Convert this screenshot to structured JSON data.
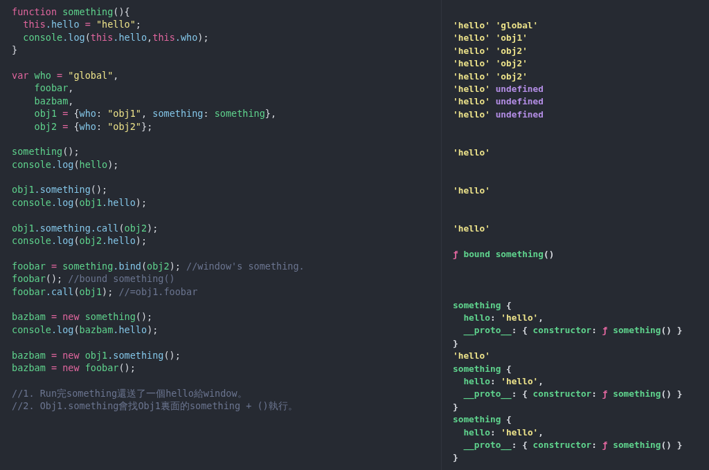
{
  "editor": {
    "lines": [
      {
        "kind": "code",
        "tokens": [
          {
            "kind": "keyword",
            "text": "function"
          },
          {
            "kind": "function",
            "text": " something"
          },
          {
            "kind": "punct",
            "text": "(){"
          }
        ]
      },
      {
        "kind": "code",
        "tokens": [
          {
            "kind": "keyword",
            "text": "  this"
          },
          {
            "kind": "property",
            "text": ".hello"
          },
          {
            "kind": "keyword",
            "text": " ="
          },
          {
            "kind": "string",
            "text": " \"hello\""
          },
          {
            "kind": "punct",
            "text": ";"
          }
        ]
      },
      {
        "kind": "code",
        "tokens": [
          {
            "kind": "function",
            "text": "  console"
          },
          {
            "kind": "property",
            "text": ".log"
          },
          {
            "kind": "punct",
            "text": "("
          },
          {
            "kind": "keyword",
            "text": "this"
          },
          {
            "kind": "property",
            "text": ".hello"
          },
          {
            "kind": "punct",
            "text": ","
          },
          {
            "kind": "keyword",
            "text": "this"
          },
          {
            "kind": "property",
            "text": ".who"
          },
          {
            "kind": "punct",
            "text": ");"
          }
        ]
      },
      {
        "kind": "code",
        "tokens": [
          {
            "kind": "punct",
            "text": "}"
          }
        ]
      },
      {
        "kind": "blank"
      },
      {
        "kind": "code",
        "tokens": [
          {
            "kind": "keyword",
            "text": "var"
          },
          {
            "kind": "function",
            "text": " who"
          },
          {
            "kind": "keyword",
            "text": " ="
          },
          {
            "kind": "string",
            "text": " \"global\""
          },
          {
            "kind": "punct",
            "text": ","
          }
        ]
      },
      {
        "kind": "code",
        "tokens": [
          {
            "kind": "function",
            "text": "    foobar"
          },
          {
            "kind": "punct",
            "text": ","
          }
        ]
      },
      {
        "kind": "code",
        "tokens": [
          {
            "kind": "function",
            "text": "    bazbam"
          },
          {
            "kind": "punct",
            "text": ","
          }
        ]
      },
      {
        "kind": "code",
        "tokens": [
          {
            "kind": "function",
            "text": "    obj1"
          },
          {
            "kind": "keyword",
            "text": " ="
          },
          {
            "kind": "punct",
            "text": " {"
          },
          {
            "kind": "property",
            "text": "who"
          },
          {
            "kind": "punct",
            "text": ": "
          },
          {
            "kind": "string",
            "text": "\"obj1\""
          },
          {
            "kind": "punct",
            "text": ", "
          },
          {
            "kind": "property",
            "text": "something"
          },
          {
            "kind": "punct",
            "text": ": "
          },
          {
            "kind": "function",
            "text": "something"
          },
          {
            "kind": "punct",
            "text": "},"
          }
        ]
      },
      {
        "kind": "code",
        "tokens": [
          {
            "kind": "function",
            "text": "    obj2"
          },
          {
            "kind": "keyword",
            "text": " ="
          },
          {
            "kind": "punct",
            "text": " {"
          },
          {
            "kind": "property",
            "text": "who"
          },
          {
            "kind": "punct",
            "text": ": "
          },
          {
            "kind": "string",
            "text": "\"obj2\""
          },
          {
            "kind": "punct",
            "text": "};"
          }
        ]
      },
      {
        "kind": "blank"
      },
      {
        "kind": "code",
        "tokens": [
          {
            "kind": "function",
            "text": "something"
          },
          {
            "kind": "punct",
            "text": "();"
          }
        ]
      },
      {
        "kind": "code",
        "tokens": [
          {
            "kind": "function",
            "text": "console"
          },
          {
            "kind": "property",
            "text": ".log"
          },
          {
            "kind": "punct",
            "text": "("
          },
          {
            "kind": "function",
            "text": "hello"
          },
          {
            "kind": "punct",
            "text": ");"
          }
        ]
      },
      {
        "kind": "blank"
      },
      {
        "kind": "code",
        "tokens": [
          {
            "kind": "function",
            "text": "obj1"
          },
          {
            "kind": "property",
            "text": ".something"
          },
          {
            "kind": "punct",
            "text": "();"
          }
        ]
      },
      {
        "kind": "code",
        "tokens": [
          {
            "kind": "function",
            "text": "console"
          },
          {
            "kind": "property",
            "text": ".log"
          },
          {
            "kind": "punct",
            "text": "("
          },
          {
            "kind": "function",
            "text": "obj1"
          },
          {
            "kind": "property",
            "text": ".hello"
          },
          {
            "kind": "punct",
            "text": ");"
          }
        ]
      },
      {
        "kind": "blank"
      },
      {
        "kind": "code",
        "tokens": [
          {
            "kind": "function",
            "text": "obj1"
          },
          {
            "kind": "property",
            "text": ".something.call"
          },
          {
            "kind": "punct",
            "text": "("
          },
          {
            "kind": "function",
            "text": "obj2"
          },
          {
            "kind": "punct",
            "text": ");"
          }
        ]
      },
      {
        "kind": "code",
        "tokens": [
          {
            "kind": "function",
            "text": "console"
          },
          {
            "kind": "property",
            "text": ".log"
          },
          {
            "kind": "punct",
            "text": "("
          },
          {
            "kind": "function",
            "text": "obj2"
          },
          {
            "kind": "property",
            "text": ".hello"
          },
          {
            "kind": "punct",
            "text": ");"
          }
        ]
      },
      {
        "kind": "blank"
      },
      {
        "kind": "code",
        "tokens": [
          {
            "kind": "function",
            "text": "foobar"
          },
          {
            "kind": "keyword",
            "text": " ="
          },
          {
            "kind": "function",
            "text": " something"
          },
          {
            "kind": "property",
            "text": ".bind"
          },
          {
            "kind": "punct",
            "text": "("
          },
          {
            "kind": "function",
            "text": "obj2"
          },
          {
            "kind": "punct",
            "text": "); "
          },
          {
            "kind": "comment",
            "text": "//window's something."
          }
        ]
      },
      {
        "kind": "code",
        "tokens": [
          {
            "kind": "function",
            "text": "foobar"
          },
          {
            "kind": "punct",
            "text": "(); "
          },
          {
            "kind": "comment",
            "text": "//bound something()"
          }
        ]
      },
      {
        "kind": "code",
        "tokens": [
          {
            "kind": "function",
            "text": "foobar"
          },
          {
            "kind": "property",
            "text": ".call"
          },
          {
            "kind": "punct",
            "text": "("
          },
          {
            "kind": "function",
            "text": "obj1"
          },
          {
            "kind": "punct",
            "text": "); "
          },
          {
            "kind": "comment",
            "text": "//=obj1.foobar"
          }
        ]
      },
      {
        "kind": "blank"
      },
      {
        "kind": "code",
        "tokens": [
          {
            "kind": "function",
            "text": "bazbam"
          },
          {
            "kind": "keyword",
            "text": " = new"
          },
          {
            "kind": "function",
            "text": " something"
          },
          {
            "kind": "punct",
            "text": "();"
          }
        ]
      },
      {
        "kind": "code",
        "tokens": [
          {
            "kind": "function",
            "text": "console"
          },
          {
            "kind": "property",
            "text": ".log"
          },
          {
            "kind": "punct",
            "text": "("
          },
          {
            "kind": "function",
            "text": "bazbam"
          },
          {
            "kind": "property",
            "text": ".hello"
          },
          {
            "kind": "punct",
            "text": ");"
          }
        ]
      },
      {
        "kind": "blank"
      },
      {
        "kind": "code",
        "tokens": [
          {
            "kind": "function",
            "text": "bazbam"
          },
          {
            "kind": "keyword",
            "text": " = new"
          },
          {
            "kind": "function",
            "text": " obj1"
          },
          {
            "kind": "property",
            "text": ".something"
          },
          {
            "kind": "punct",
            "text": "();"
          }
        ]
      },
      {
        "kind": "code",
        "tokens": [
          {
            "kind": "function",
            "text": "bazbam"
          },
          {
            "kind": "keyword",
            "text": " = new"
          },
          {
            "kind": "function",
            "text": " foobar"
          },
          {
            "kind": "punct",
            "text": "();"
          }
        ]
      },
      {
        "kind": "blank"
      },
      {
        "kind": "code",
        "tokens": [
          {
            "kind": "comment",
            "text": "//1. Run完something還送了一個hello給window。"
          }
        ]
      },
      {
        "kind": "code",
        "tokens": [
          {
            "kind": "comment",
            "text": "//2. Obj1.something會找Obj1裏面的something + ()執行。"
          }
        ]
      }
    ]
  },
  "console": {
    "lines": [
      {
        "kind": "code",
        "tokens": [
          {
            "kind": "string",
            "text": "'hello' 'global'"
          }
        ]
      },
      {
        "kind": "code",
        "tokens": [
          {
            "kind": "string",
            "text": "'hello' 'obj1'"
          }
        ]
      },
      {
        "kind": "code",
        "tokens": [
          {
            "kind": "string",
            "text": "'hello' 'obj2'"
          }
        ]
      },
      {
        "kind": "code",
        "tokens": [
          {
            "kind": "string",
            "text": "'hello' 'obj2'"
          }
        ]
      },
      {
        "kind": "code",
        "tokens": [
          {
            "kind": "string",
            "text": "'hello' 'obj2'"
          }
        ]
      },
      {
        "kind": "code",
        "tokens": [
          {
            "kind": "string",
            "text": "'hello'"
          },
          {
            "kind": "undefined",
            "text": " undefined"
          }
        ]
      },
      {
        "kind": "code",
        "tokens": [
          {
            "kind": "string",
            "text": "'hello'"
          },
          {
            "kind": "undefined",
            "text": " undefined"
          }
        ]
      },
      {
        "kind": "code",
        "tokens": [
          {
            "kind": "string",
            "text": "'hello'"
          },
          {
            "kind": "undefined",
            "text": " undefined"
          }
        ]
      },
      {
        "kind": "blank"
      },
      {
        "kind": "blank"
      },
      {
        "kind": "code",
        "tokens": [
          {
            "kind": "string",
            "text": "'hello'"
          }
        ]
      },
      {
        "kind": "blank"
      },
      {
        "kind": "blank"
      },
      {
        "kind": "code",
        "tokens": [
          {
            "kind": "string",
            "text": "'hello'"
          }
        ]
      },
      {
        "kind": "blank"
      },
      {
        "kind": "blank"
      },
      {
        "kind": "code",
        "tokens": [
          {
            "kind": "string",
            "text": "'hello'"
          }
        ]
      },
      {
        "kind": "blank"
      },
      {
        "kind": "code",
        "tokens": [
          {
            "kind": "keyword",
            "text": "ƒ"
          },
          {
            "kind": "function",
            "text": " bound something"
          },
          {
            "kind": "punct",
            "text": "()"
          }
        ]
      },
      {
        "kind": "blank"
      },
      {
        "kind": "blank"
      },
      {
        "kind": "blank"
      },
      {
        "kind": "code",
        "tokens": [
          {
            "kind": "function",
            "text": "something"
          },
          {
            "kind": "punct",
            "text": " {"
          }
        ]
      },
      {
        "kind": "code",
        "tokens": [
          {
            "kind": "function",
            "text": "  hello"
          },
          {
            "kind": "punct",
            "text": ": "
          },
          {
            "kind": "string",
            "text": "'hello'"
          },
          {
            "kind": "punct",
            "text": ","
          }
        ]
      },
      {
        "kind": "code",
        "tokens": [
          {
            "kind": "function",
            "text": "  __proto__"
          },
          {
            "kind": "punct",
            "text": ": { "
          },
          {
            "kind": "function",
            "text": "constructor"
          },
          {
            "kind": "punct",
            "text": ": "
          },
          {
            "kind": "keyword",
            "text": "ƒ"
          },
          {
            "kind": "function",
            "text": " something"
          },
          {
            "kind": "punct",
            "text": "() }"
          }
        ]
      },
      {
        "kind": "code",
        "tokens": [
          {
            "kind": "punct",
            "text": "}"
          }
        ]
      },
      {
        "kind": "code",
        "tokens": [
          {
            "kind": "string",
            "text": "'hello'"
          }
        ]
      },
      {
        "kind": "code",
        "tokens": [
          {
            "kind": "function",
            "text": "something"
          },
          {
            "kind": "punct",
            "text": " {"
          }
        ]
      },
      {
        "kind": "code",
        "tokens": [
          {
            "kind": "function",
            "text": "  hello"
          },
          {
            "kind": "punct",
            "text": ": "
          },
          {
            "kind": "string",
            "text": "'hello'"
          },
          {
            "kind": "punct",
            "text": ","
          }
        ]
      },
      {
        "kind": "code",
        "tokens": [
          {
            "kind": "function",
            "text": "  __proto__"
          },
          {
            "kind": "punct",
            "text": ": { "
          },
          {
            "kind": "function",
            "text": "constructor"
          },
          {
            "kind": "punct",
            "text": ": "
          },
          {
            "kind": "keyword",
            "text": "ƒ"
          },
          {
            "kind": "function",
            "text": " something"
          },
          {
            "kind": "punct",
            "text": "() }"
          }
        ]
      },
      {
        "kind": "code",
        "tokens": [
          {
            "kind": "punct",
            "text": "}"
          }
        ]
      },
      {
        "kind": "code",
        "tokens": [
          {
            "kind": "function",
            "text": "something"
          },
          {
            "kind": "punct",
            "text": " {"
          }
        ]
      },
      {
        "kind": "code",
        "tokens": [
          {
            "kind": "function",
            "text": "  hello"
          },
          {
            "kind": "punct",
            "text": ": "
          },
          {
            "kind": "string",
            "text": "'hello'"
          },
          {
            "kind": "punct",
            "text": ","
          }
        ]
      },
      {
        "kind": "code",
        "tokens": [
          {
            "kind": "function",
            "text": "  __proto__"
          },
          {
            "kind": "punct",
            "text": ": { "
          },
          {
            "kind": "function",
            "text": "constructor"
          },
          {
            "kind": "punct",
            "text": ": "
          },
          {
            "kind": "keyword",
            "text": "ƒ"
          },
          {
            "kind": "function",
            "text": " something"
          },
          {
            "kind": "punct",
            "text": "() }"
          }
        ]
      },
      {
        "kind": "code",
        "tokens": [
          {
            "kind": "punct",
            "text": "}"
          }
        ]
      }
    ]
  }
}
